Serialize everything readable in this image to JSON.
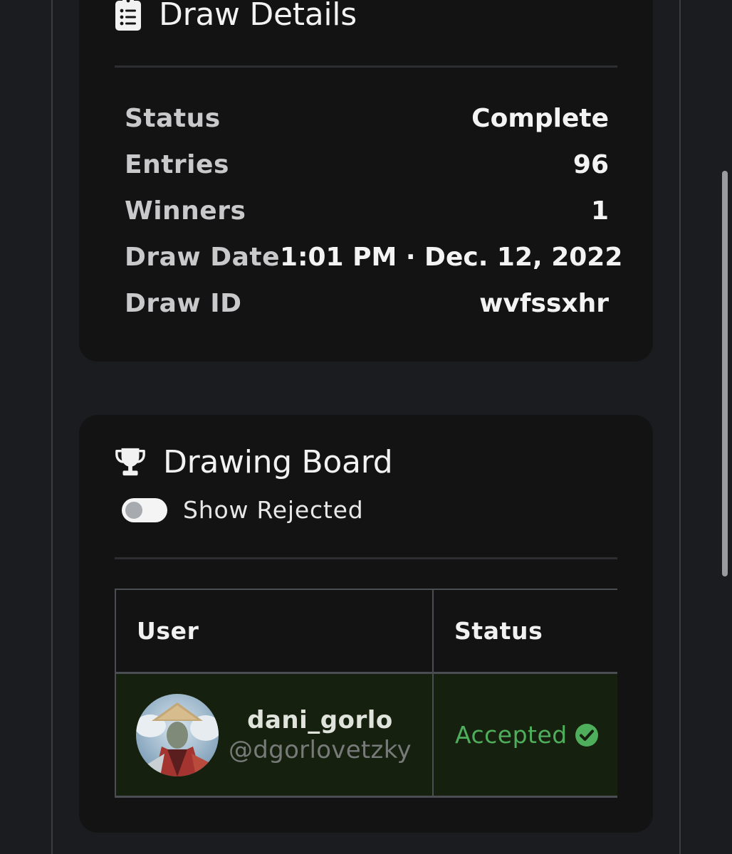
{
  "draw_details": {
    "title": "Draw Details",
    "icon": "clipboard-list-icon",
    "rows": [
      {
        "label": "Status",
        "value": "Complete"
      },
      {
        "label": "Entries",
        "value": "96"
      },
      {
        "label": "Winners",
        "value": "1"
      },
      {
        "label": "Draw Date",
        "value": "1:01 PM · Dec. 12, 2022"
      },
      {
        "label": "Draw ID",
        "value": "wvfssxhr"
      }
    ]
  },
  "drawing_board": {
    "title": "Drawing Board",
    "icon": "trophy-icon",
    "toggle": {
      "label": "Show Rejected",
      "on": false
    },
    "table": {
      "columns": [
        "User",
        "Status"
      ],
      "rows": [
        {
          "display_name": "dani_gorlo",
          "handle": "@dgorlovetzky",
          "status": "Accepted",
          "status_icon": "check-circle-icon"
        }
      ]
    }
  },
  "colors": {
    "background": "#1b1c1f",
    "card": "#131314",
    "accepted_green": "#4fae5b",
    "accepted_row_bg": "#16200f"
  }
}
